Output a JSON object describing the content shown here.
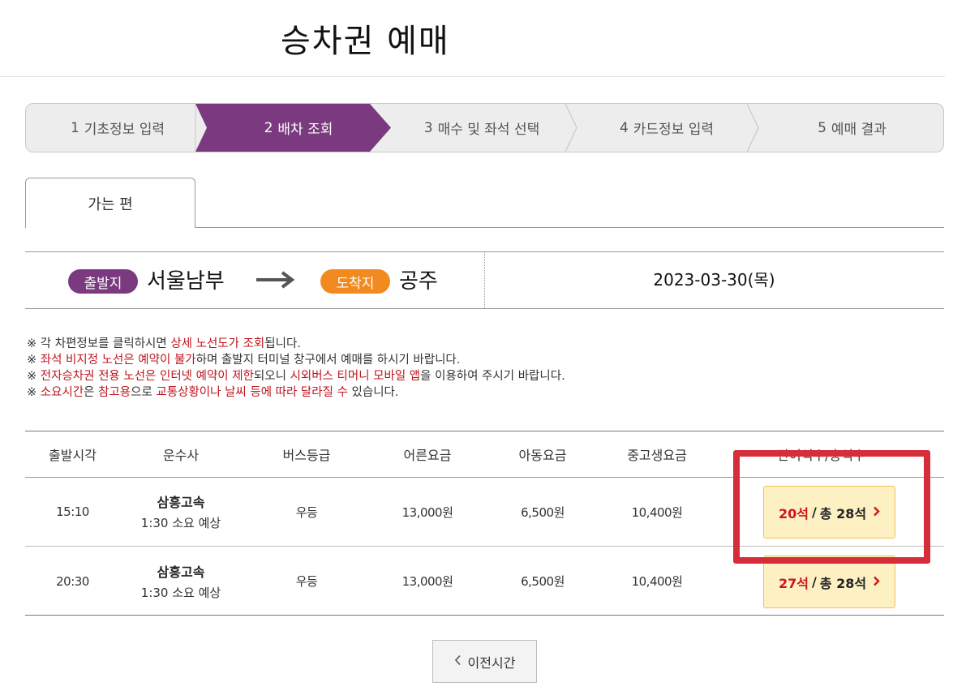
{
  "page": {
    "title": "승차권 예매"
  },
  "steps": [
    {
      "num": "1",
      "label": "기초정보 입력",
      "active": false
    },
    {
      "num": "2",
      "label": "배차 조회",
      "active": true
    },
    {
      "num": "3",
      "label": "매수 및 좌석 선택",
      "active": false
    },
    {
      "num": "4",
      "label": "카드정보 입력",
      "active": false
    },
    {
      "num": "5",
      "label": "예매 결과",
      "active": false
    }
  ],
  "tabs": {
    "outbound": "가는 편"
  },
  "route": {
    "departure_badge": "출발지",
    "departure": "서울남부",
    "arrival_badge": "도착지",
    "arrival": "공주",
    "date": "2023-03-30(목)"
  },
  "notes": [
    {
      "parts": [
        {
          "t": "※ 각 차편정보를 클릭하시면 "
        },
        {
          "t": "상세 노선도가 조회",
          "red": true
        },
        {
          "t": "됩니다."
        }
      ]
    },
    {
      "parts": [
        {
          "t": "※ "
        },
        {
          "t": "좌석 비지정 노선은 예약이 불가",
          "red": true
        },
        {
          "t": "하며 출발지 터미널 창구에서 예매를 하시기 바랍니다."
        }
      ]
    },
    {
      "parts": [
        {
          "t": "※ "
        },
        {
          "t": "전자승차권 전용 노선은 인터넷 예약이 제한",
          "red": true
        },
        {
          "t": "되오니 "
        },
        {
          "t": "시외버스 티머니 모바일 앱",
          "red": true
        },
        {
          "t": "을 이용하여 주시기 바랍니다."
        }
      ]
    },
    {
      "parts": [
        {
          "t": "※ "
        },
        {
          "t": "소요시간",
          "red": true
        },
        {
          "t": "은 "
        },
        {
          "t": "참고용",
          "red": true
        },
        {
          "t": "으로 "
        },
        {
          "t": "교통상황이나 날씨 등에 따라 달라질 수",
          "red": true
        },
        {
          "t": " 있습니다."
        }
      ]
    }
  ],
  "table": {
    "headers": [
      "출발시각",
      "운수사",
      "버스등급",
      "어른요금",
      "아동요금",
      "중고생요금",
      "잔여석수/총석수"
    ],
    "rows": [
      {
        "time": "15:10",
        "company": "삼흥고속",
        "duration": "1:30 소요 예상",
        "grade": "우등",
        "adult": "13,000원",
        "child": "6,500원",
        "teen": "10,400원",
        "remaining": "20석",
        "total": "총 28석"
      },
      {
        "time": "20:30",
        "company": "삼흥고속",
        "duration": "1:30 소요 예상",
        "grade": "우등",
        "adult": "13,000원",
        "child": "6,500원",
        "teen": "10,400원",
        "remaining": "27석",
        "total": "총 28석"
      }
    ]
  },
  "buttons": {
    "prev_label": "이전시간"
  },
  "colors": {
    "active_step": "#7b3a7f",
    "departure_badge": "#7b3a7f",
    "arrival_badge": "#f28a1f",
    "highlight": "#d62d3a",
    "accent_red": "#c0161c"
  },
  "icons": {
    "route_arrow": "long-arrow-right-icon",
    "seat_arrow": "chevron-right-icon",
    "prev": "chevron-left-icon"
  }
}
